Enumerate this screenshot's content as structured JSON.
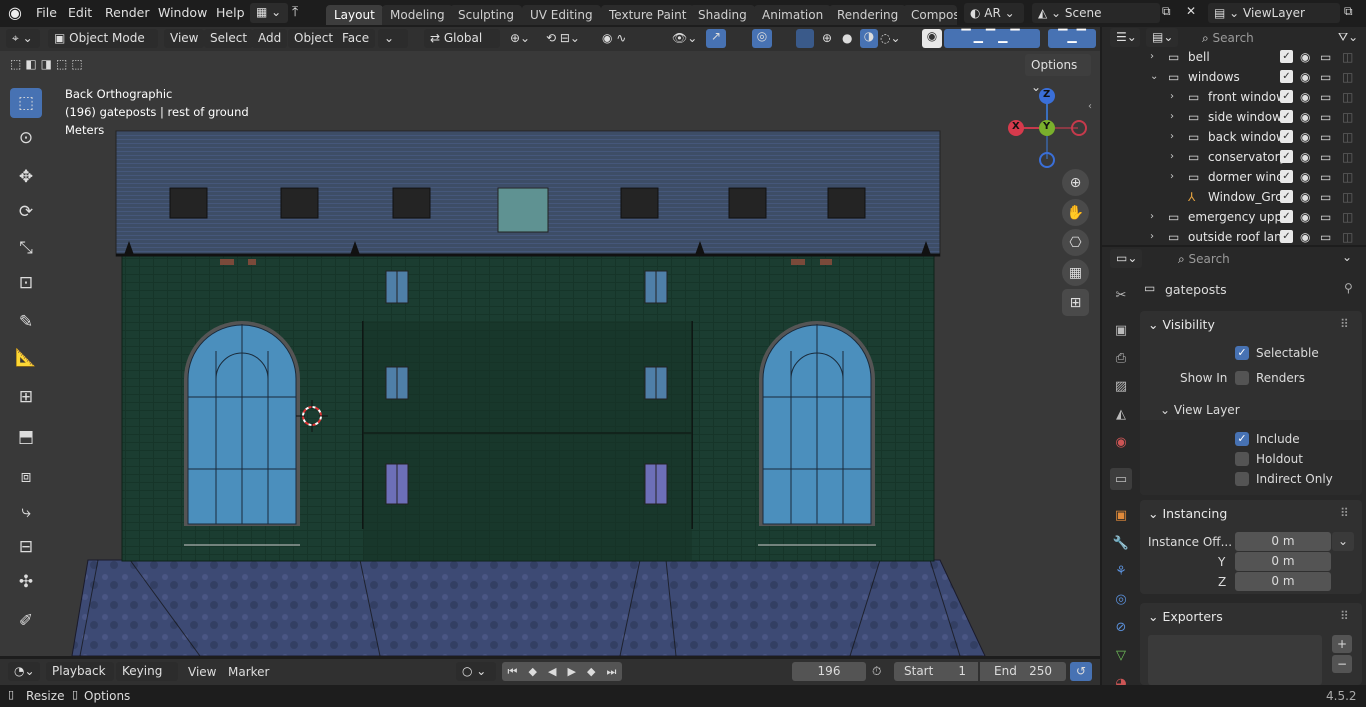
{
  "topbar": {
    "menus": [
      "File",
      "Edit",
      "Render",
      "Window",
      "Help"
    ],
    "workspaces": [
      "Layout",
      "Modeling",
      "Sculpting",
      "UV Editing",
      "Texture Paint",
      "Shading",
      "Animation",
      "Rendering",
      "Compos"
    ],
    "active_workspace": "Layout",
    "renderer_short": "AR",
    "scene_name": "Scene",
    "view_layer": "ViewLayer"
  },
  "viewport_header": {
    "mode": "Object Mode",
    "menus": [
      "View",
      "Select",
      "Add",
      "Object",
      "Face"
    ],
    "transform_orientation": "Global",
    "options_label": "Options"
  },
  "viewport": {
    "view_name": "Back Orthographic",
    "collection_info": "(196) gateposts | rest of ground",
    "units": "Meters",
    "gizmo_axes": {
      "x": "X",
      "y": "Y",
      "z": "Z"
    }
  },
  "outliner": {
    "search_placeholder": "Search",
    "items": [
      {
        "label": "bell",
        "indent": 1,
        "expanded": false
      },
      {
        "label": "windows",
        "indent": 1,
        "expanded": true
      },
      {
        "label": "front window",
        "indent": 2,
        "expanded": false
      },
      {
        "label": "side window",
        "indent": 2,
        "expanded": false
      },
      {
        "label": "back window",
        "indent": 2,
        "expanded": false
      },
      {
        "label": "conservatory",
        "indent": 2,
        "expanded": false
      },
      {
        "label": "dormer wind",
        "indent": 2,
        "expanded": false
      },
      {
        "label": "Window_Gro",
        "indent": 2,
        "expanded": false
      },
      {
        "label": "emergency uppe",
        "indent": 1,
        "expanded": false
      },
      {
        "label": "outside roof lant",
        "indent": 1,
        "expanded": false
      }
    ]
  },
  "properties": {
    "search_placeholder": "Search",
    "object_name": "gateposts",
    "visibility": {
      "title": "Visibility",
      "selectable_label": "Selectable",
      "selectable": true,
      "show_in_label": "Show In",
      "renders_label": "Renders",
      "renders": false,
      "view_layer_title": "View Layer",
      "include_label": "Include",
      "include": true,
      "holdout_label": "Holdout",
      "holdout": false,
      "indirect_only_label": "Indirect Only",
      "indirect_only": false
    },
    "instancing": {
      "title": "Instancing",
      "offset_label": "Instance Off...",
      "x_value": "0 m",
      "y_label": "Y",
      "y_value": "0 m",
      "z_label": "Z",
      "z_value": "0 m"
    },
    "exporters": {
      "title": "Exporters"
    }
  },
  "timeline": {
    "playback_label": "Playback",
    "keying_label": "Keying",
    "view_label": "View",
    "marker_label": "Marker",
    "current_frame": "196",
    "start_label": "Start",
    "start_value": "1",
    "end_label": "End",
    "end_value": "250"
  },
  "statusbar": {
    "resize_label": "Resize",
    "options_label": "Options",
    "version": "4.5.2"
  },
  "colors": {
    "accent": "#4772b3",
    "wall": "#16352b",
    "roof": "#3d4d66",
    "window_glass": "#4b8fbd",
    "ground": "#3f4c7a"
  }
}
